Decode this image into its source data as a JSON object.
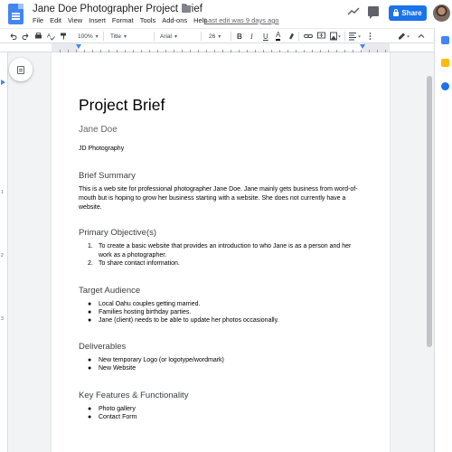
{
  "header": {
    "doc_title": "Jane Doe Photographer Project Brief",
    "star_icon": "star-icon",
    "folder_icon": "folder-icon",
    "last_edit": "Last edit was 9 days ago",
    "share_label": "Share",
    "menu": [
      "File",
      "Edit",
      "View",
      "Insert",
      "Format",
      "Tools",
      "Add-ons",
      "Help"
    ]
  },
  "toolbar": {
    "zoom": "100%",
    "style": "Title",
    "font": "Arial",
    "font_size": "26",
    "bold": "B",
    "italic": "I",
    "underline": "U",
    "text_color": "A"
  },
  "ruler_v": [
    "1",
    "2",
    "3"
  ],
  "document": {
    "title": "Project Brief",
    "subtitle": "Jane Doe",
    "author": "JD Photography",
    "sections": [
      {
        "heading": "Brief Summary",
        "paragraph": "This is a web site for professional photographer Jane Doe. Jane mainly gets business from word-of-mouth but is hoping to grow her business starting with a website. She does not currently have a website."
      },
      {
        "heading": "Primary Objective(s)",
        "items": [
          "To create a basic website that provides an introduction to who Jane is as a person and her work as a photographer.",
          "To share contact information."
        ]
      },
      {
        "heading": "Target Audience",
        "items": [
          "Local Oahu couples getting married.",
          "Families hosting birthday parties.",
          "Jane (client) needs to be able to update her photos occasionally."
        ]
      },
      {
        "heading": "Deliverables",
        "items": [
          "New temporary Logo (or logotype/wordmark)",
          "New Website"
        ]
      },
      {
        "heading": "Key Features & Functionality",
        "items": [
          "Photo gallery",
          "Contact Form"
        ]
      }
    ]
  },
  "colors": {
    "accent": "#1a73e8",
    "doc_icon": "#4285f4",
    "heading": "#3c4043",
    "subtitle": "#666666"
  }
}
